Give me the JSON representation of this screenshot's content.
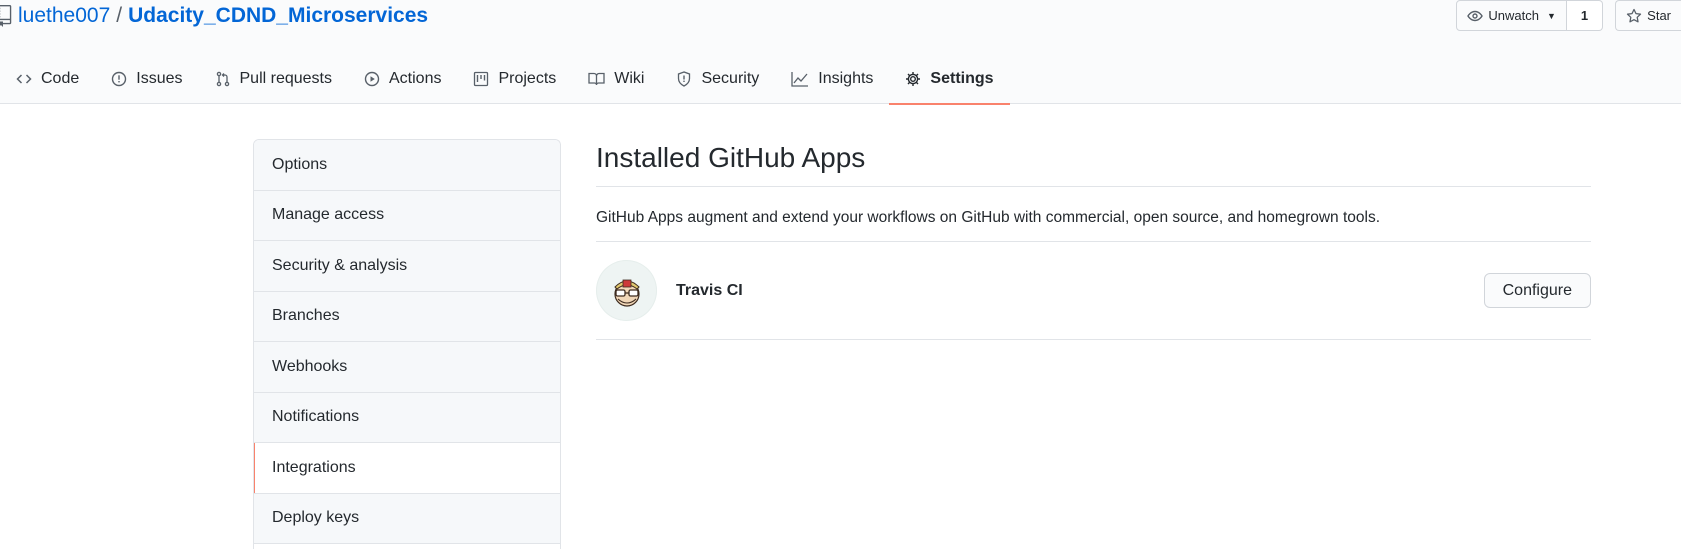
{
  "repo": {
    "owner": "luethe007",
    "separator": "/",
    "name": "Udacity_CDND_Microservices"
  },
  "actions": {
    "watch_label": "Unwatch",
    "watch_count": "1",
    "star_label": "Star"
  },
  "tabs": [
    {
      "label": "Code",
      "icon": "code-icon"
    },
    {
      "label": "Issues",
      "icon": "issue-icon"
    },
    {
      "label": "Pull requests",
      "icon": "pull-request-icon"
    },
    {
      "label": "Actions",
      "icon": "play-icon"
    },
    {
      "label": "Projects",
      "icon": "project-icon"
    },
    {
      "label": "Wiki",
      "icon": "book-icon"
    },
    {
      "label": "Security",
      "icon": "shield-icon"
    },
    {
      "label": "Insights",
      "icon": "graph-icon"
    },
    {
      "label": "Settings",
      "icon": "gear-icon",
      "selected": true
    }
  ],
  "menu": [
    {
      "label": "Options"
    },
    {
      "label": "Manage access"
    },
    {
      "label": "Security & analysis"
    },
    {
      "label": "Branches"
    },
    {
      "label": "Webhooks"
    },
    {
      "label": "Notifications"
    },
    {
      "label": "Integrations",
      "selected": true
    },
    {
      "label": "Deploy keys"
    }
  ],
  "main": {
    "title": "Installed GitHub Apps",
    "description": "GitHub Apps augment and extend your workflows on GitHub with commercial, open source, and homegrown tools.",
    "apps": [
      {
        "name": "Travis CI",
        "configure_label": "Configure"
      }
    ]
  },
  "colors": {
    "link": "#0366d6",
    "selected_underline": "#f9826c",
    "border": "#e1e4e8"
  }
}
